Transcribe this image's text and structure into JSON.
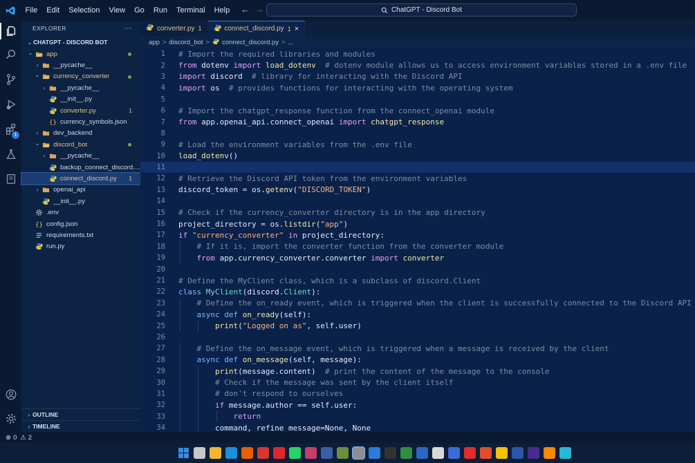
{
  "window": {
    "search_text": "ChatGPT - Discord Bot",
    "menu": [
      "File",
      "Edit",
      "Selection",
      "View",
      "Go",
      "Run",
      "Terminal",
      "Help"
    ]
  },
  "activity": {
    "extensions_badge": "1"
  },
  "sidebar": {
    "title": "EXPLORER",
    "more": "···",
    "section": "CHATGPT - DISCORD BOT",
    "tree": [
      {
        "label": "app",
        "indent": 0,
        "kind": "folder-open",
        "color": "yellow",
        "dot": true
      },
      {
        "label": "__pycache__",
        "indent": 1,
        "kind": "folder",
        "color": "normal"
      },
      {
        "label": "currency_converter",
        "indent": 1,
        "kind": "folder-open",
        "color": "yellow",
        "dot": true
      },
      {
        "label": "__pycache__",
        "indent": 2,
        "kind": "folder",
        "color": "normal"
      },
      {
        "label": "__init__.py",
        "indent": 2,
        "kind": "py",
        "color": "normal"
      },
      {
        "label": "converter.py",
        "indent": 2,
        "kind": "py",
        "color": "yellow",
        "mark": "1"
      },
      {
        "label": "currency_symbols.json",
        "indent": 2,
        "kind": "json",
        "color": "normal"
      },
      {
        "label": "dev_backend",
        "indent": 1,
        "kind": "folder",
        "color": "normal"
      },
      {
        "label": "discord_bot",
        "indent": 1,
        "kind": "folder-open",
        "color": "yellow",
        "dot": true
      },
      {
        "label": "__pycache__",
        "indent": 2,
        "kind": "folder",
        "color": "normal"
      },
      {
        "label": "backup_connect_discord....",
        "indent": 2,
        "kind": "py",
        "color": "normal"
      },
      {
        "label": "connect_discord.py",
        "indent": 2,
        "kind": "py",
        "color": "yellow",
        "mark": "1",
        "selected": true
      },
      {
        "label": "openai_api",
        "indent": 1,
        "kind": "folder",
        "color": "normal"
      },
      {
        "label": "__init__.py",
        "indent": 1,
        "kind": "py",
        "color": "normal"
      },
      {
        "label": ".env",
        "indent": 0,
        "kind": "gear",
        "color": "normal"
      },
      {
        "label": "config.json",
        "indent": 0,
        "kind": "json",
        "color": "normal"
      },
      {
        "label": "requirements.txt",
        "indent": 0,
        "kind": "txt",
        "color": "normal"
      },
      {
        "label": "run.py",
        "indent": 0,
        "kind": "py",
        "color": "normal"
      }
    ],
    "outline": "OUTLINE",
    "timeline": "TIMELINE"
  },
  "tabs": [
    {
      "label": "converter.py",
      "mark": "1",
      "active": false
    },
    {
      "label": "connect_discord.py",
      "mark": "1",
      "active": true,
      "close": "×"
    }
  ],
  "breadcrumb": [
    "app",
    "discord_bot",
    "connect_discord.py",
    "..."
  ],
  "breadcrumb_sep": ">",
  "editor": {
    "current_line": 11,
    "lines": [
      [
        [
          "c-com",
          "# Import the required libraries and modules"
        ]
      ],
      [
        [
          "c-kw",
          "from"
        ],
        [
          "c-var",
          " dotenv "
        ],
        [
          "c-kw",
          "import"
        ],
        [
          "c-fn",
          " load_dotenv"
        ],
        [
          "c-com",
          "  # dotenv module allows us to access environment variables stored in a .env file"
        ]
      ],
      [
        [
          "c-kw",
          "import"
        ],
        [
          "c-var",
          " discord"
        ],
        [
          "c-com",
          "  # library for interacting with the Discord API"
        ]
      ],
      [
        [
          "c-kw",
          "import"
        ],
        [
          "c-var",
          " os"
        ],
        [
          "c-com",
          "  # provides functions for interacting with the operating system"
        ]
      ],
      [],
      [
        [
          "c-com",
          "# Import the chatgpt_response function from the connect_openai module"
        ]
      ],
      [
        [
          "c-kw",
          "from"
        ],
        [
          "c-var",
          " app.openai_api.connect_openai "
        ],
        [
          "c-kw",
          "import"
        ],
        [
          "c-fn",
          " chatgpt_response"
        ]
      ],
      [],
      [
        [
          "c-com",
          "# Load the environment variables from the .env file"
        ]
      ],
      [
        [
          "c-fn",
          "load_dotenv"
        ],
        [
          "c-var",
          "()"
        ]
      ],
      [],
      [
        [
          "c-com",
          "# Retrieve the Discord API token from the environment variables"
        ]
      ],
      [
        [
          "c-var",
          "discord_token = os."
        ],
        [
          "c-fn",
          "getenv"
        ],
        [
          "c-var",
          "("
        ],
        [
          "c-str",
          "\"DISCORD_TOKEN\""
        ],
        [
          "c-var",
          ")"
        ]
      ],
      [],
      [
        [
          "c-com",
          "# Check if the currency_converter directory is in the app directory"
        ]
      ],
      [
        [
          "c-var",
          "project_directory = os."
        ],
        [
          "c-fn",
          "listdir"
        ],
        [
          "c-var",
          "("
        ],
        [
          "c-str",
          "\"app\""
        ],
        [
          "c-var",
          ")"
        ]
      ],
      [
        [
          "c-kw",
          "if"
        ],
        [
          "c-str",
          " \"currency_converter\""
        ],
        [
          "c-kw",
          " in"
        ],
        [
          "c-var",
          " project_directory:"
        ]
      ],
      [
        [
          "c-com",
          "    # If it is, import the converter function from the converter module"
        ]
      ],
      [
        [
          "c-kw",
          "    from"
        ],
        [
          "c-var",
          " app.currency_converter.converter "
        ],
        [
          "c-kw",
          "import"
        ],
        [
          "c-fn",
          " converter"
        ]
      ],
      [],
      [
        [
          "c-com",
          "# Define the MyClient class, which is a subclass of discord.Client"
        ]
      ],
      [
        [
          "c-def",
          "class"
        ],
        [
          "c-cls",
          " MyClient"
        ],
        [
          "c-var",
          "(discord."
        ],
        [
          "c-cls",
          "Client"
        ],
        [
          "c-var",
          "):"
        ]
      ],
      [
        [
          "c-com",
          "    # Define the on_ready event, which is triggered when the client is successfully connected to the Discord API"
        ]
      ],
      [
        [
          "c-def",
          "    async def"
        ],
        [
          "c-fn",
          " on_ready"
        ],
        [
          "c-var",
          "(self):"
        ]
      ],
      [
        [
          "c-fn",
          "        print"
        ],
        [
          "c-var",
          "("
        ],
        [
          "c-str",
          "\"Logged on as\""
        ],
        [
          "c-var",
          ", self.user)"
        ]
      ],
      [],
      [
        [
          "c-com",
          "    # Define the on_message event, which is triggered when a message is received by the client"
        ]
      ],
      [
        [
          "c-def",
          "    async def"
        ],
        [
          "c-fn",
          " on_message"
        ],
        [
          "c-var",
          "(self, message):"
        ]
      ],
      [
        [
          "c-fn",
          "        print"
        ],
        [
          "c-var",
          "(message.content)"
        ],
        [
          "c-com",
          "  # print the content of the message to the console"
        ]
      ],
      [
        [
          "c-com",
          "        # Check if the message was sent by the client itself"
        ]
      ],
      [
        [
          "c-com",
          "        # don't respond to ourselves"
        ]
      ],
      [
        [
          "c-kw",
          "        if"
        ],
        [
          "c-var",
          " message.author == self.user:"
        ]
      ],
      [
        [
          "c-kw",
          "            return"
        ]
      ],
      [
        [
          "c-var",
          "        command, refine_message=None, None"
        ]
      ]
    ]
  },
  "status": {
    "errors": "0",
    "warnings": "2"
  },
  "taskbar_colors": [
    "#2d7fe0",
    "#c7c7c7",
    "#f2b632",
    "#1b8fd8",
    "#e66000",
    "#d9362b",
    "#e0262e",
    "#25d366",
    "#c73d6a",
    "#3a5fa8",
    "#6a8f3e",
    "#8f8f8f",
    "#2b7bd8",
    "#333",
    "#2f8f3f",
    "#2b67c7",
    "#d8d8d8",
    "#3a6bd8",
    "#e22b2b",
    "#e04e2b",
    "#f2c200",
    "#2a55a8",
    "#4b2b8f",
    "#ff8800",
    "#2ab7d8"
  ]
}
